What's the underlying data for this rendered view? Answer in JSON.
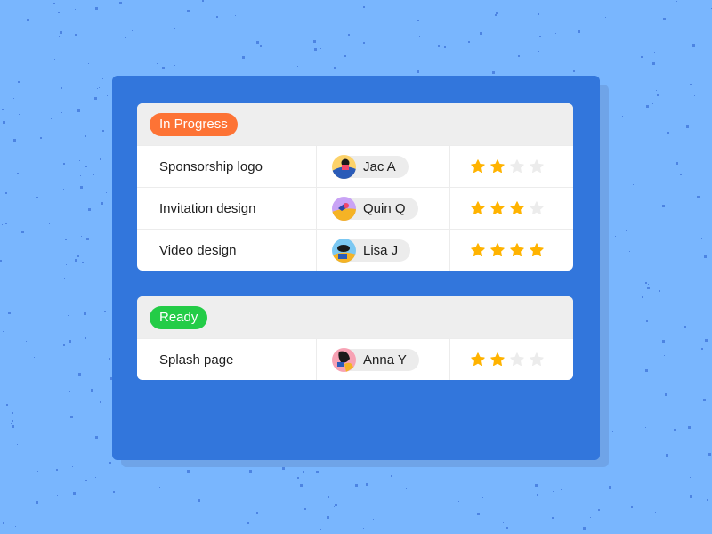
{
  "colors": {
    "background": "#79b6fe",
    "panel": "#3276dc",
    "header": "#eeeeee",
    "star_filled": "#ffb300",
    "star_empty": "#ececec"
  },
  "groups": [
    {
      "status": "In Progress",
      "status_color": "#fd7335",
      "rows": [
        {
          "task": "Sponsorship logo",
          "assignee": "Jac A",
          "avatar": "avatar-jac",
          "rating": 2,
          "max_rating": 4
        },
        {
          "task": "Invitation design",
          "assignee": "Quin Q",
          "avatar": "avatar-quin",
          "rating": 3,
          "max_rating": 4
        },
        {
          "task": "Video design",
          "assignee": "Lisa J",
          "avatar": "avatar-lisa",
          "rating": 4,
          "max_rating": 4
        }
      ]
    },
    {
      "status": "Ready",
      "status_color": "#23cc47",
      "rows": [
        {
          "task": "Splash page",
          "assignee": "Anna Y",
          "avatar": "avatar-anna",
          "rating": 2,
          "max_rating": 4
        }
      ]
    }
  ]
}
